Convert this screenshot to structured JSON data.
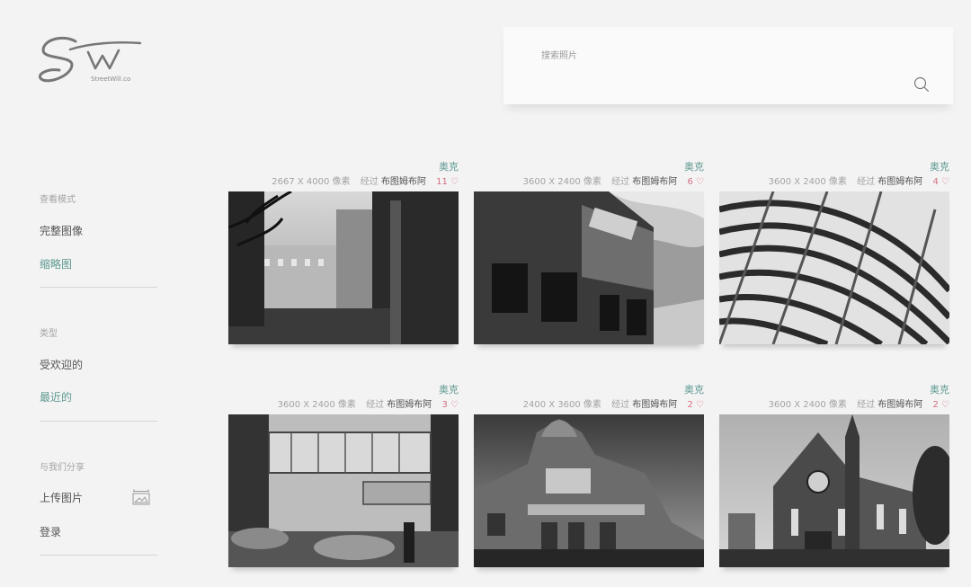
{
  "logo": {
    "mark": "SW",
    "site_name": "StreetWill.co"
  },
  "search": {
    "placeholder": "搜索照片"
  },
  "sidebar": {
    "view_mode_label": "查看模式",
    "view_modes": [
      {
        "label": "完整图像",
        "active": false
      },
      {
        "label": "缩略图",
        "active": true
      }
    ],
    "type_label": "类型",
    "types": [
      {
        "label": "受欢迎的",
        "active": false
      },
      {
        "label": "最近的",
        "active": true
      }
    ],
    "share_label": "与我们分享",
    "upload_label": "上传图片",
    "login_label": "登录",
    "upload_icon": "image-upload-icon"
  },
  "colors": {
    "accent": "#5d9a92",
    "likes": "#d46f84",
    "background": "#f4f3f3"
  },
  "photos": [
    {
      "author": "奥克",
      "dimensions": "2667 X 4000 像素",
      "by_label": "经过",
      "location": "布图姆布阿",
      "likes": "11",
      "heart_icon": "heart-icon"
    },
    {
      "author": "奥克",
      "dimensions": "3600 X 2400 像素",
      "by_label": "经过",
      "location": "布图姆布阿",
      "likes": "6",
      "heart_icon": "heart-icon"
    },
    {
      "author": "奥克",
      "dimensions": "3600 X 2400 像素",
      "by_label": "经过",
      "location": "布图姆布阿",
      "likes": "4",
      "heart_icon": "heart-icon"
    },
    {
      "author": "奥克",
      "dimensions": "3600 X 2400 像素",
      "by_label": "经过",
      "location": "布图姆布阿",
      "likes": "3",
      "heart_icon": "heart-icon"
    },
    {
      "author": "奥克",
      "dimensions": "2400 X 3600 像素",
      "by_label": "经过",
      "location": "布图姆布阿",
      "likes": "2",
      "heart_icon": "heart-icon"
    },
    {
      "author": "奥克",
      "dimensions": "3600 X 2400 像素",
      "by_label": "经过",
      "location": "布图姆布阿",
      "likes": "2",
      "heart_icon": "heart-icon"
    }
  ]
}
